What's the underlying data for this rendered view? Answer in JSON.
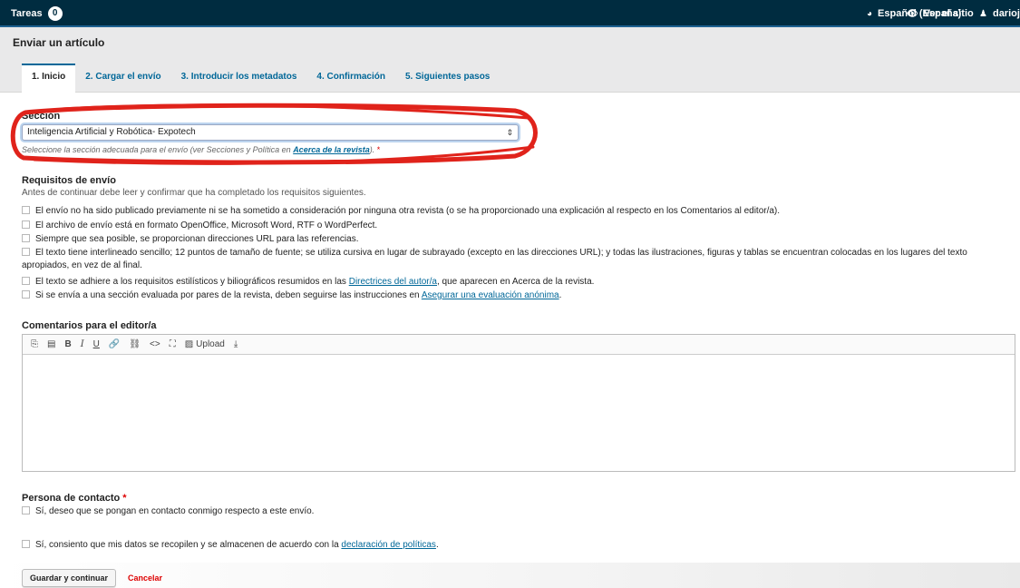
{
  "topbar": {
    "tasks_label": "Tareas",
    "tasks_count": "0",
    "language": "Español (España)",
    "view_site": "Ver el sitio",
    "user": "dariojos"
  },
  "page": {
    "title": "Enviar un artículo"
  },
  "tabs": [
    {
      "label": "1. Inicio",
      "active": true
    },
    {
      "label": "2. Cargar el envío",
      "active": false
    },
    {
      "label": "3. Introducir los metadatos",
      "active": false
    },
    {
      "label": "4. Confirmación",
      "active": false
    },
    {
      "label": "5. Siguientes pasos",
      "active": false
    }
  ],
  "section": {
    "label": "Sección",
    "selected": "Inteligencia Artificial y Robótica- Expotech",
    "help_text": "Seleccione la sección adecuada para el envío (ver Secciones y Política en ",
    "help_link": "Acerca de la revista",
    "help_suffix": ").",
    "required_mark": "*"
  },
  "requirements": {
    "title": "Requisitos de envío",
    "intro": "Antes de continuar debe leer y confirmar que ha completado los requisitos siguientes.",
    "items": [
      {
        "text": "El envío no ha sido publicado previamente ni se ha sometido a consideración por ninguna otra revista (o se ha proporcionado una explicación al respecto en los Comentarios al editor/a)."
      },
      {
        "text": "El archivo de envío está en formato OpenOffice, Microsoft Word, RTF o WordPerfect."
      },
      {
        "text": "Siempre que sea posible, se proporcionan direcciones URL para las referencias."
      },
      {
        "text": "El texto tiene interlineado sencillo; 12 puntos de tamaño de fuente; se utiliza cursiva en lugar de subrayado (excepto en las direcciones URL); y todas las ilustraciones, figuras y tablas se encuentran colocadas en los lugares del texto apropiados, en vez de al final."
      },
      {
        "text_before": "El texto se adhiere a los requisitos estilísticos y biliográficos resumidos en las ",
        "link": "Directrices del autor/a",
        "text_after": ", que aparecen en Acerca de la revista."
      },
      {
        "text_before": "Si se envía a una sección evaluada por pares de la revista, deben seguirse las instrucciones en ",
        "link": "Asegurar una evaluación anónima",
        "text_after": "."
      }
    ]
  },
  "editor": {
    "title": "Comentarios para el editor/a",
    "toolbar": {
      "bold": "B",
      "italic": "I",
      "underline": "U",
      "code": "<>",
      "upload": "Upload"
    }
  },
  "contact": {
    "title": "Persona de contacto",
    "required_mark": "*",
    "consent_contact": "Sí, deseo que se pongan en contacto conmigo respecto a este envío.",
    "consent_data_before": "Sí, consiento que mis datos se recopilen y se almacenen de acuerdo con la ",
    "consent_data_link": "declaración de políticas",
    "consent_data_after": "."
  },
  "actions": {
    "save": "Guardar y continuar",
    "cancel": "Cancelar"
  }
}
